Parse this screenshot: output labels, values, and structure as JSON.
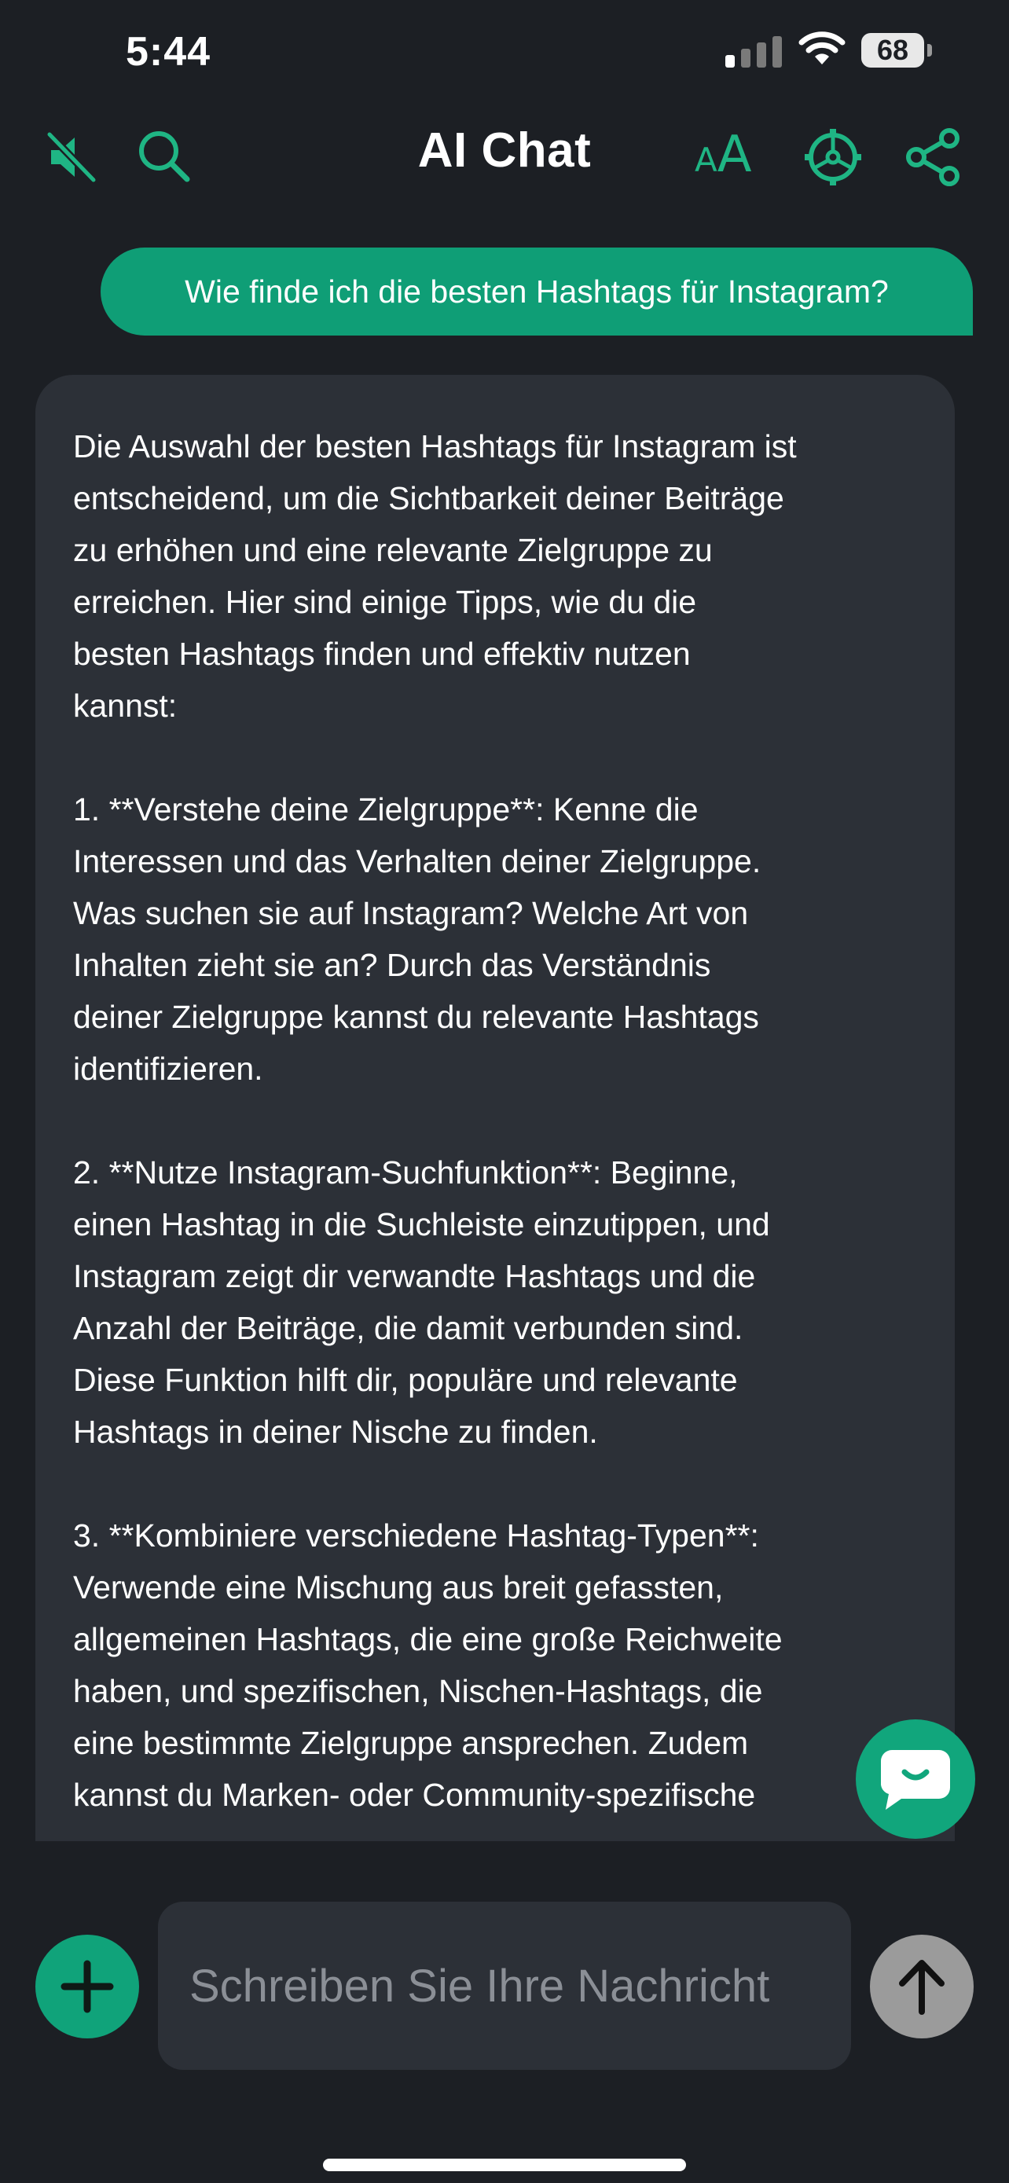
{
  "status_bar": {
    "time": "5:44",
    "battery": "68"
  },
  "header": {
    "title": "AI Chat",
    "icons": [
      "mute-icon",
      "search-icon",
      "font-size-icon",
      "settings-icon",
      "share-icon"
    ],
    "font_size_small": "A",
    "font_size_large": "A"
  },
  "messages": [
    {
      "role": "user",
      "text": "Wie finde ich die besten Hashtags für Instagram?"
    },
    {
      "role": "assistant",
      "text": "Die Auswahl der besten Hashtags für Instagram ist\nentscheidend, um die Sichtbarkeit deiner Beiträge\nzu erhöhen und eine relevante Zielgruppe zu\nerreichen. Hier sind einige Tipps, wie du die\nbesten Hashtags finden und effektiv nutzen\nkannst:\n\n1. **Verstehe deine Zielgruppe**: Kenne die\nInteressen und das Verhalten deiner Zielgruppe.\nWas suchen sie auf Instagram? Welche Art von\nInhalten zieht sie an? Durch das Verständnis\ndeiner Zielgruppe kannst du relevante Hashtags\nidentifizieren.\n\n2. **Nutze Instagram-Suchfunktion**: Beginne,\neinen Hashtag in die Suchleiste einzutippen, und\nInstagram zeigt dir verwandte Hashtags und die\nAnzahl der Beiträge, die damit verbunden sind.\nDiese Funktion hilft dir, populäre und relevante\nHashtags in deiner Nische zu finden.\n\n3. **Kombiniere verschiedene Hashtag-Typen**:\nVerwende eine Mischung aus breit gefassten,\nallgemeinen Hashtags, die eine große Reichweite\nhaben, und spezifischen, Nischen-Hashtags, die\neine bestimmte Zielgruppe ansprechen. Zudem\nkannst du Marken- oder Community-spezifische"
    }
  ],
  "composer": {
    "placeholder": "Schreiben Sie Ihre Nachricht",
    "value": ""
  },
  "colors": {
    "accent": "#10a37a",
    "background": "#1c1f24",
    "bubble_ai": "#2c3037",
    "send_disabled": "#9b9b9b"
  }
}
